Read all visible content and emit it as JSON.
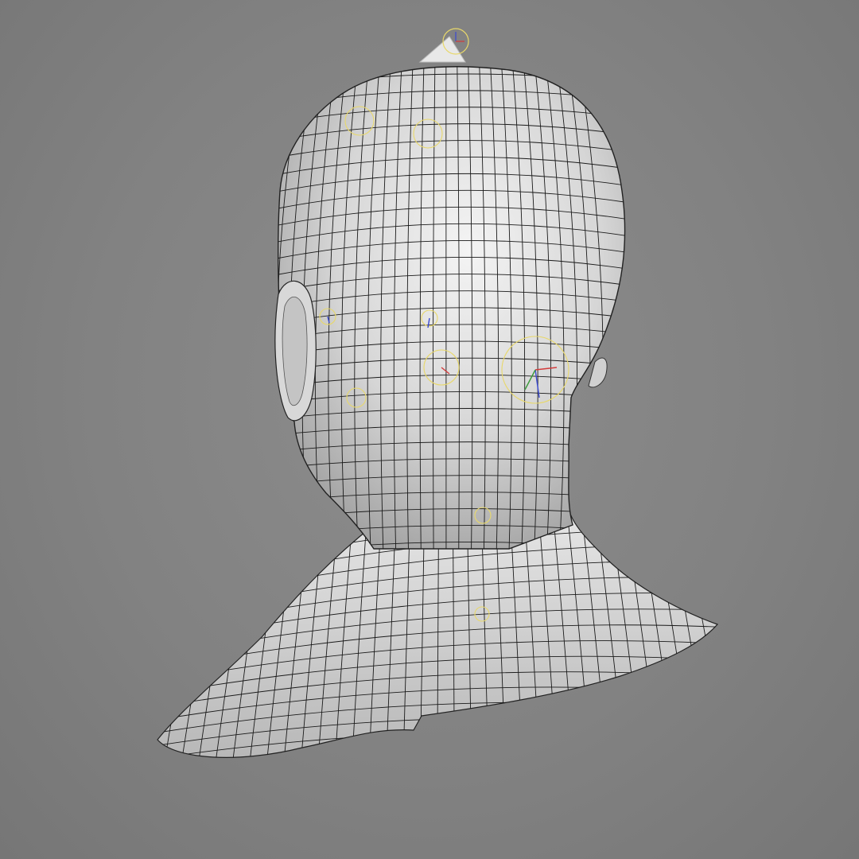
{
  "viewport": {
    "background_color": "#828282",
    "mesh_surface_color": "#dcdcdc",
    "mesh_wire_color": "#1a1a1a",
    "manipulator_color": "#e8d86a",
    "axis_x_color": "#d23a3a",
    "axis_y_color": "#3a9a3a",
    "axis_z_color": "#3a4ad2",
    "object": "head-neck-mesh",
    "display_mode": "wireframe-on-shaded"
  }
}
